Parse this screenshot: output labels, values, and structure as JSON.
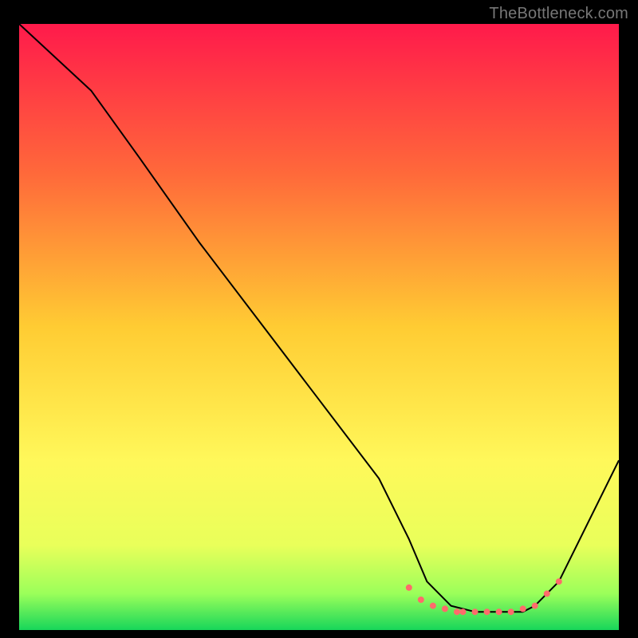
{
  "watermark": "TheBottleneck.com",
  "chart_data": {
    "type": "line",
    "title": "",
    "xlabel": "",
    "ylabel": "",
    "xlim": [
      0,
      100
    ],
    "ylim": [
      0,
      100
    ],
    "grid": false,
    "legend": false,
    "gradient_stops": [
      {
        "offset": 0.0,
        "color": "#ff1a4b"
      },
      {
        "offset": 0.25,
        "color": "#ff6a3a"
      },
      {
        "offset": 0.5,
        "color": "#ffcc33"
      },
      {
        "offset": 0.72,
        "color": "#fff85a"
      },
      {
        "offset": 0.86,
        "color": "#e9ff5a"
      },
      {
        "offset": 0.94,
        "color": "#9bff5a"
      },
      {
        "offset": 1.0,
        "color": "#17d65a"
      }
    ],
    "series": [
      {
        "name": "bottleneck-curve",
        "stroke": "#000000",
        "stroke_width": 2,
        "x": [
          0,
          12,
          20,
          30,
          40,
          50,
          60,
          65,
          68,
          72,
          76,
          80,
          84,
          86,
          90,
          95,
          100
        ],
        "values": [
          100,
          89,
          78,
          64,
          51,
          38,
          25,
          15,
          8,
          4,
          3,
          3,
          3,
          4,
          8,
          18,
          28
        ]
      }
    ],
    "markers": {
      "name": "flat-region-dots",
      "color": "#ff6b6b",
      "radius": 4,
      "x": [
        65,
        67,
        69,
        71,
        73,
        74,
        76,
        78,
        80,
        82,
        84,
        86,
        88,
        90
      ],
      "values": [
        7,
        5,
        4,
        3.5,
        3,
        3,
        3,
        3,
        3,
        3,
        3.5,
        4,
        6,
        8
      ]
    }
  }
}
